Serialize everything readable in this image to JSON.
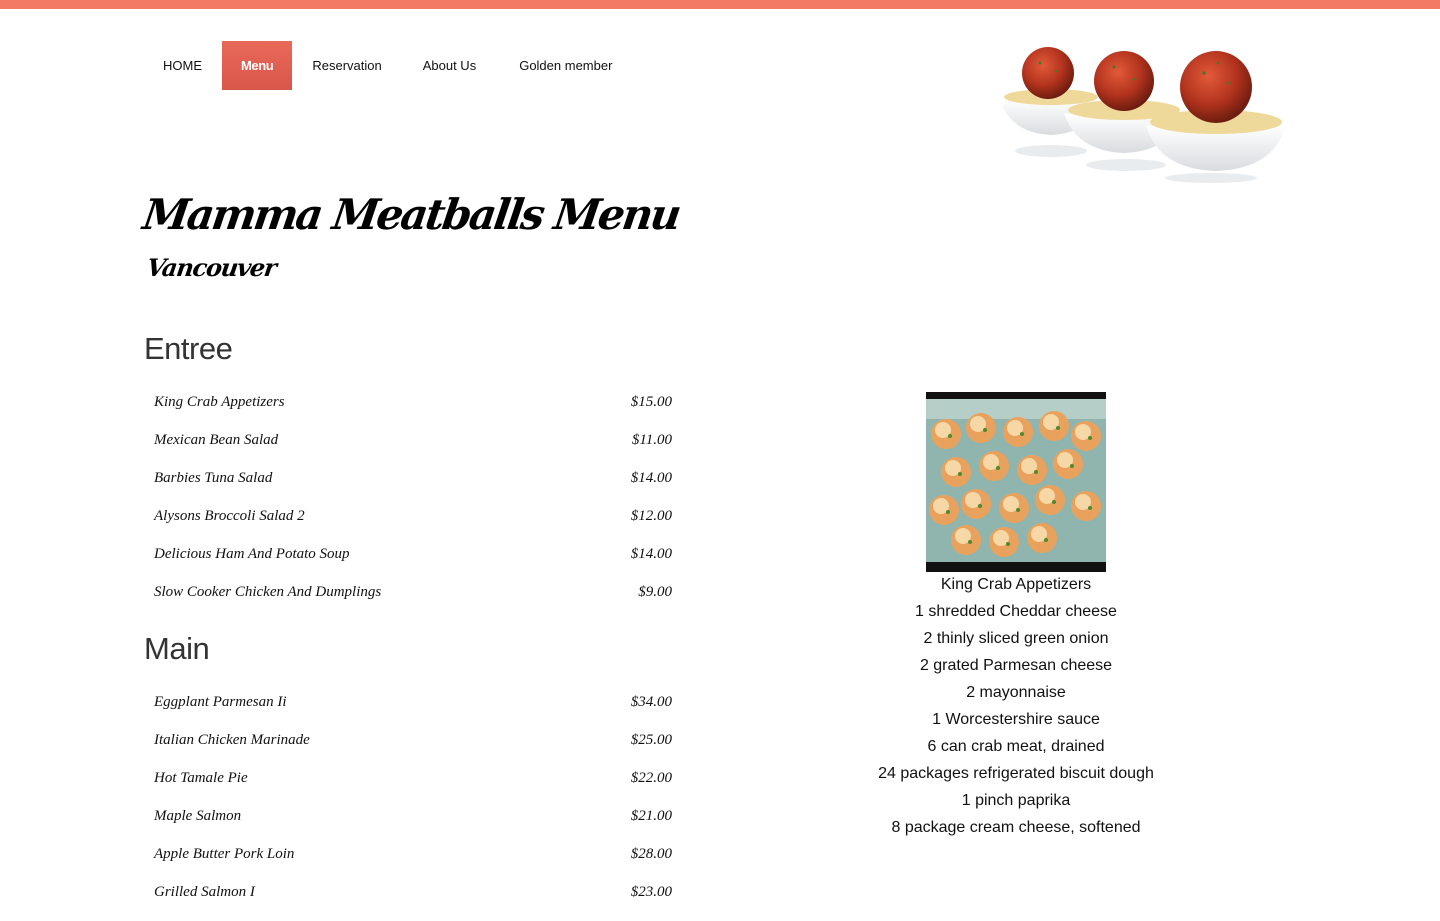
{
  "colors": {
    "accent": "#f47b63",
    "nav_active": "#d9574a",
    "page_bg": "#ffffff"
  },
  "nav": {
    "items": [
      {
        "label": "HOME"
      },
      {
        "label": "Menu",
        "active": true
      },
      {
        "label": "Reservation"
      },
      {
        "label": "About Us"
      },
      {
        "label": "Golden member"
      }
    ]
  },
  "hero": {
    "icon": "meatball-spaghetti-bowls-image"
  },
  "header": {
    "title": "Mamma Meatballs Menu",
    "subtitle": "Vancouver"
  },
  "sections": [
    {
      "title": "Entree",
      "items": [
        {
          "name": "King Crab Appetizers",
          "price": "$15.00"
        },
        {
          "name": "Mexican Bean Salad",
          "price": "$11.00"
        },
        {
          "name": "Barbies Tuna Salad",
          "price": "$14.00"
        },
        {
          "name": "Alysons Broccoli Salad 2",
          "price": "$12.00"
        },
        {
          "name": "Delicious Ham And Potato Soup",
          "price": "$14.00"
        },
        {
          "name": "Slow Cooker Chicken And Dumplings",
          "price": "$9.00"
        }
      ]
    },
    {
      "title": "Main",
      "items": [
        {
          "name": "Eggplant Parmesan Ii",
          "price": "$34.00"
        },
        {
          "name": "Italian Chicken Marinade",
          "price": "$25.00"
        },
        {
          "name": "Hot Tamale Pie",
          "price": "$22.00"
        },
        {
          "name": "Maple Salmon",
          "price": "$21.00"
        },
        {
          "name": "Apple Butter Pork Loin",
          "price": "$28.00"
        },
        {
          "name": "Grilled Salmon I",
          "price": "$23.00"
        }
      ]
    }
  ],
  "detail": {
    "photo_icon": "crab-appetizer-photo",
    "name": "King Crab Appetizers",
    "ingredients": [
      "1 shredded Cheddar cheese",
      "2 thinly sliced green onion",
      "2 grated Parmesan cheese",
      "2 mayonnaise",
      "1 Worcestershire sauce",
      "6 can crab meat, drained",
      "24 packages refrigerated biscuit dough",
      "1 pinch paprika",
      "8 package cream cheese, softened"
    ]
  }
}
